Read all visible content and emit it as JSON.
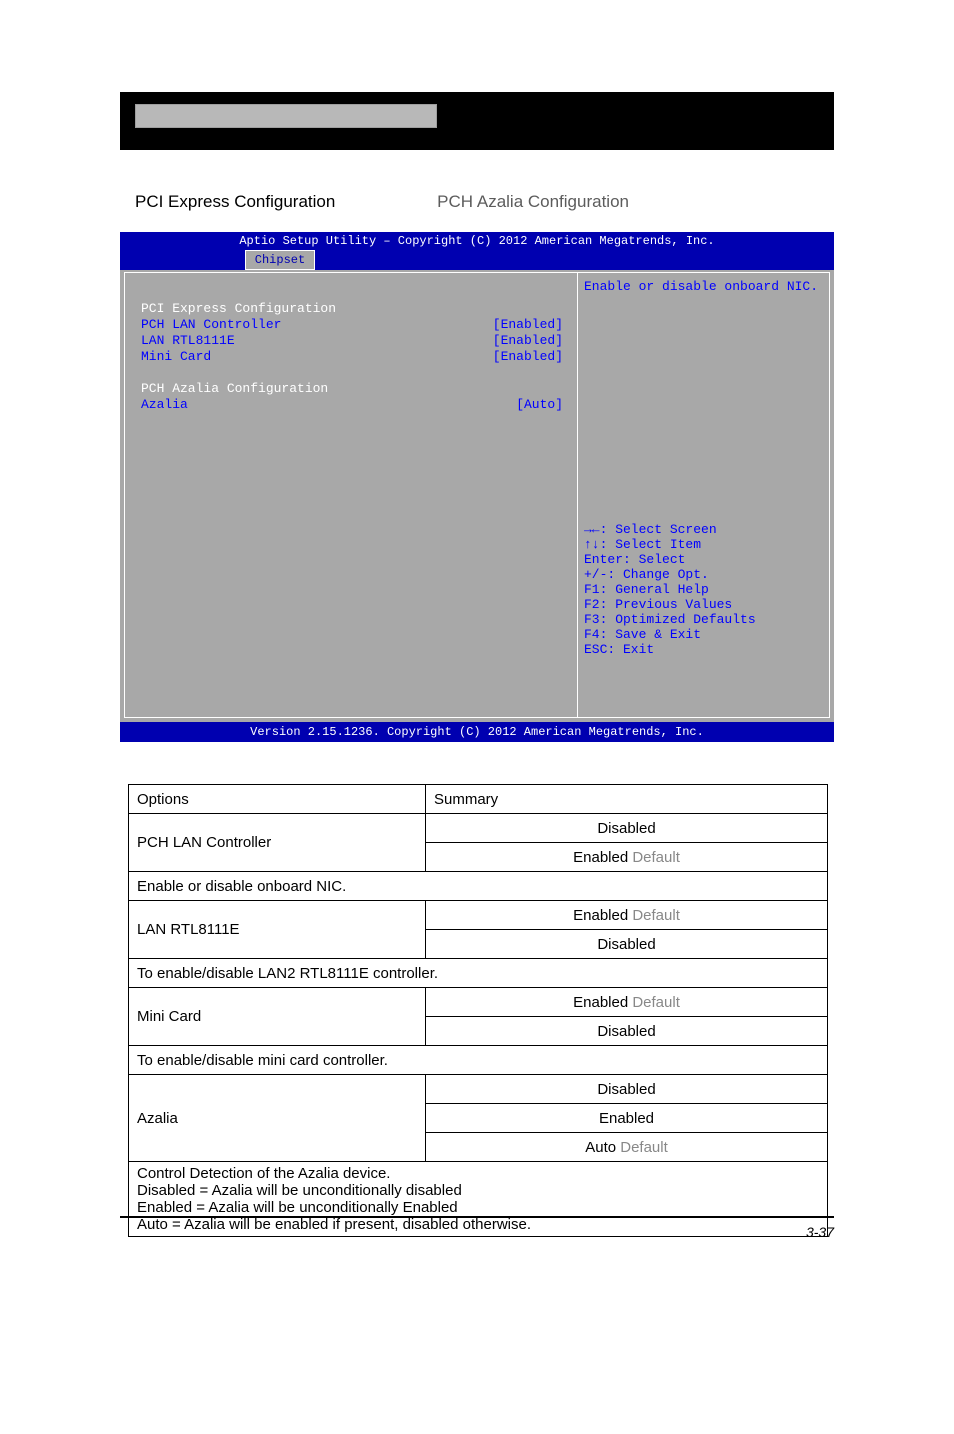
{
  "subheader": {
    "left": "PCI Express Configuration",
    "right": "PCH Azalia Configuration"
  },
  "bios": {
    "title": "Aptio Setup Utility – Copyright (C) 2012 American Megatrends, Inc.",
    "tab_label": "Chipset",
    "footer": "Version 2.15.1236. Copyright (C) 2012 American Megatrends, Inc.",
    "help_text": "Enable or disable onboard NIC.",
    "left_items": [
      {
        "label": "PCI Express Configuration",
        "value": "",
        "color": "white"
      },
      {
        "label": "PCH LAN Controller",
        "value": "[Enabled]",
        "color": "blue",
        "value_color": "blue"
      },
      {
        "label": "LAN RTL8111E",
        "value": "[Enabled]",
        "color": "blue",
        "value_color": "blue"
      },
      {
        "label": "Mini Card",
        "value": "[Enabled]",
        "color": "blue",
        "value_color": "blue"
      },
      {
        "label": "",
        "value": "",
        "color": "white"
      },
      {
        "label": "PCH Azalia Configuration",
        "value": "",
        "color": "white"
      },
      {
        "label": "Azalia",
        "value": "[Auto]",
        "color": "blue",
        "value_color": "blue"
      }
    ],
    "key_hints": [
      "→←: Select Screen",
      "↑↓: Select Item",
      "Enter: Select",
      "+/-: Change Opt.",
      "F1: General Help",
      "F2: Previous Values",
      "F3: Optimized Defaults",
      "F4: Save & Exit",
      "ESC: Exit"
    ]
  },
  "options_table": {
    "header_cells": [
      "Options",
      "Summary"
    ],
    "rows": [
      {
        "label": "PCH LAN Controller",
        "values": [
          "Disabled",
          "Enabled"
        ],
        "default_idx": 1,
        "desc": "Enable or disable onboard NIC."
      },
      {
        "label": "LAN RTL8111E",
        "values": [
          "Enabled",
          "Disabled"
        ],
        "default_idx": 0,
        "desc": "To enable/disable LAN2 RTL8111E controller."
      },
      {
        "label": "Mini Card",
        "values": [
          "Enabled",
          "Disabled"
        ],
        "default_idx": 0,
        "desc": "To enable/disable mini card controller."
      },
      {
        "label": "Azalia",
        "values": [
          "Disabled",
          "Enabled",
          "Auto"
        ],
        "default_idx": 2,
        "desc": "Control Detection of the Azalia device.\nDisabled = Azalia will be unconditionally disabled\nEnabled = Azalia will be unconditionally Enabled\nAuto = Azalia will be enabled if present, disabled otherwise."
      }
    ],
    "default_word": "Default"
  },
  "page_number": "3-37"
}
